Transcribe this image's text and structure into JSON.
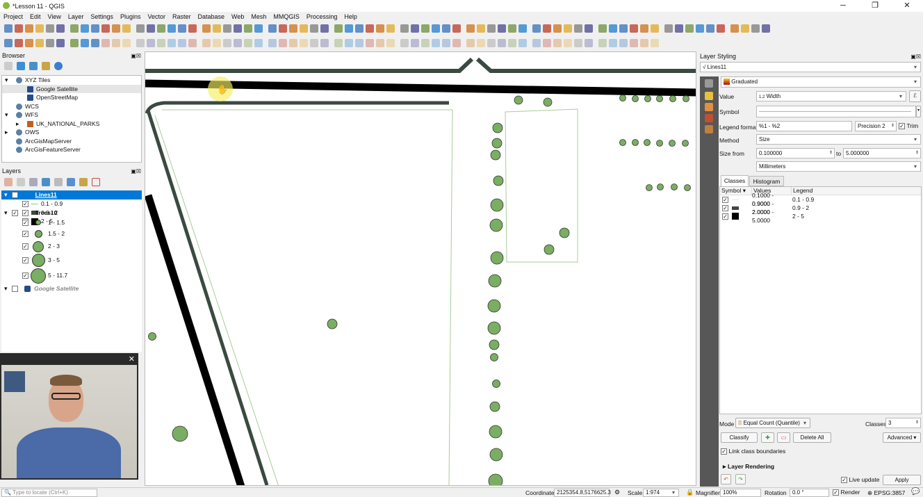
{
  "window": {
    "title": "*Lesson 11 - QGIS",
    "minimize": "─",
    "maximize": "❐",
    "close": "✕"
  },
  "menu": [
    "Project",
    "Edit",
    "View",
    "Layer",
    "Settings",
    "Plugins",
    "Vector",
    "Raster",
    "Database",
    "Web",
    "Mesh",
    "MMQGIS",
    "Processing",
    "Help"
  ],
  "browser": {
    "title": "Browser",
    "items": [
      {
        "label": "XYZ Tiles",
        "level": 0,
        "exp": "▾",
        "icon": "globe-icon"
      },
      {
        "label": "Google Satellite",
        "level": 1,
        "exp": "",
        "icon": "tile-icon"
      },
      {
        "label": "OpenStreetMap",
        "level": 1,
        "exp": "",
        "icon": "tile-icon"
      },
      {
        "label": "WCS",
        "level": 0,
        "exp": "",
        "icon": "globe-icon"
      },
      {
        "label": "WFS",
        "level": 0,
        "exp": "▾",
        "icon": "globe-icon"
      },
      {
        "label": "UK_NATIONAL_PARKS",
        "level": 1,
        "exp": "▸",
        "icon": "line-icon"
      },
      {
        "label": "OWS",
        "level": 0,
        "exp": "▸",
        "icon": "globe-icon"
      },
      {
        "label": "ArcGisMapServer",
        "level": 0,
        "exp": "",
        "icon": "globe-icon"
      },
      {
        "label": "ArcGisFeatureServer",
        "level": 0,
        "exp": "",
        "icon": "globe-icon"
      }
    ]
  },
  "layers": {
    "title": "Layers",
    "lines": {
      "name": "Lines11",
      "classes": [
        {
          "label": "0.1 - 0.9",
          "color": "#9bc08a"
        },
        {
          "label": "0.9 - 2",
          "color": "#3a4a40"
        },
        {
          "label": "2 - 5",
          "color": "#000000"
        }
      ]
    },
    "trees": {
      "name": "Trees10",
      "classes": [
        {
          "label": "1 - 1.5"
        },
        {
          "label": "1.5 - 2"
        },
        {
          "label": "2 - 3"
        },
        {
          "label": "3 - 5"
        },
        {
          "label": "5 - 11.7"
        }
      ]
    },
    "satellite": {
      "name": "Google Satellite"
    }
  },
  "styling": {
    "title": "Layer Styling",
    "layer": "Lines11",
    "renderer": "Graduated",
    "value_label": "Value",
    "value": "Width",
    "value_prefix": "1.2",
    "symbol_label": "Symbol",
    "legend_format_label": "Legend format",
    "legend_format": "%1 - %2",
    "precision": "Precision 2",
    "trim": "Trim",
    "method_label": "Method",
    "method": "Size",
    "size_from_label": "Size from",
    "size_from": "0.100000",
    "to_label": "to",
    "size_to": "5.000000",
    "unit": "Millimeters",
    "tabs": [
      "Classes",
      "Histogram"
    ],
    "columns": [
      "Symbol",
      "Values",
      "Legend"
    ],
    "rows": [
      {
        "values": "0.1000 - 0.9000",
        "legend": "0.1 - 0.9",
        "color": "#e8e8e0"
      },
      {
        "values": "0.9000 - 2.0000",
        "legend": "0.9 - 2",
        "color": "#3a4a40"
      },
      {
        "values": "2.0000 - 5.0000",
        "legend": "2 - 5",
        "color": "#000000"
      }
    ],
    "mode_label": "Mode",
    "mode": "Equal Count (Quantile)",
    "classes_label": "Classes",
    "classes": "3",
    "classify": "Classify",
    "delete_all": "Delete All",
    "advanced": "Advanced",
    "link_boundaries": "Link class boundaries",
    "layer_rendering": "Layer Rendering",
    "live_update": "Live update",
    "apply": "Apply"
  },
  "status": {
    "locate_placeholder": "Type to locate (Ctrl+K)",
    "coordinate_label": "Coordinate",
    "coordinate": "2125354.8,5176625.3",
    "scale_label": "Scale",
    "scale": "1:974",
    "magnifier_label": "Magnifier",
    "magnifier": "100%",
    "rotation_label": "Rotation",
    "rotation": "0.0 °",
    "render": "Render",
    "crs": "EPSG:3857"
  },
  "webcam": {
    "close": "✕"
  },
  "colors": {
    "tree_fill": "#7aae62",
    "selection": "#0078d7"
  }
}
